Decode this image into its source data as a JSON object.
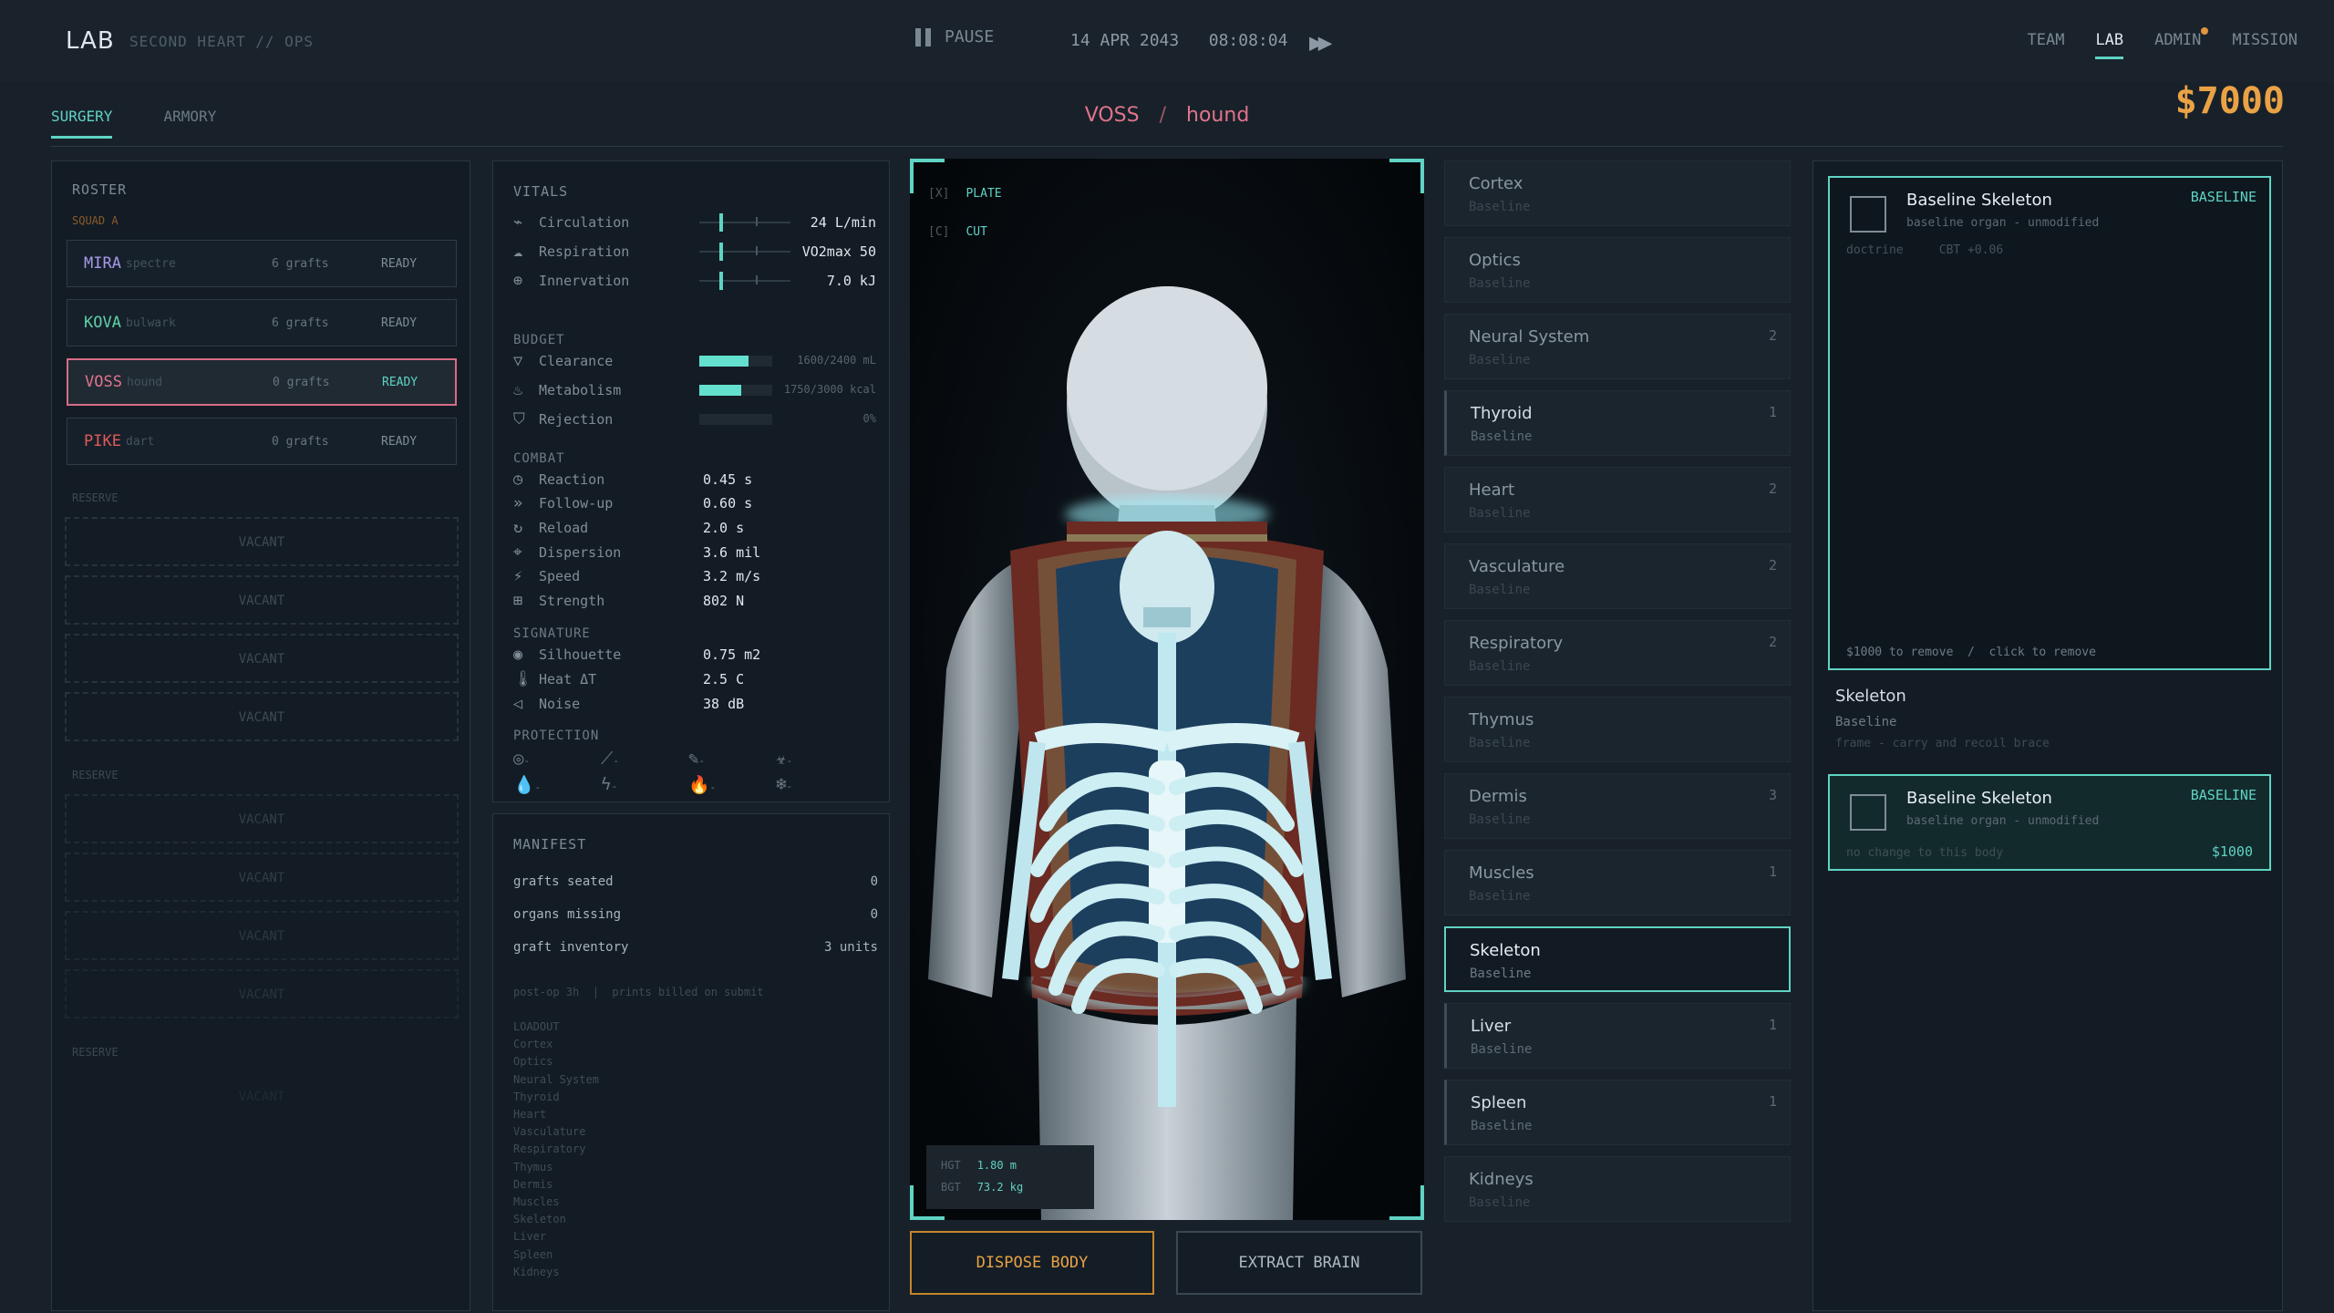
{
  "header": {
    "brand": "LAB",
    "subtitle": "SECOND HEART // OPS",
    "pause_label": "PAUSE",
    "date": "14 APR 2043",
    "time": "08:08:04",
    "nav": [
      "TEAM",
      "LAB",
      "ADMIN",
      "MISSION"
    ],
    "active_nav": "LAB"
  },
  "tabs": [
    "SURGERY",
    "ARMORY"
  ],
  "breadcrumb": {
    "name": "VOSS",
    "sep": "/",
    "callsign": "hound"
  },
  "money": "$7000",
  "roster": {
    "title": "ROSTER",
    "squad": "SQUAD A",
    "members": [
      {
        "name": "MIRA",
        "callsign": "spectre",
        "grafts": "6 grafts",
        "status": "READY",
        "color": "#a79ae8"
      },
      {
        "name": "KOVA",
        "callsign": "bulwark",
        "grafts": "6 grafts",
        "status": "READY",
        "color": "#5fd3a6"
      },
      {
        "name": "VOSS",
        "callsign": "hound",
        "grafts": "0 grafts",
        "status": "READY",
        "color": "#e0748a"
      },
      {
        "name": "PIKE",
        "callsign": "dart",
        "grafts": "0 grafts",
        "status": "READY",
        "color": "#e05a5a"
      }
    ],
    "reserve_label": "RESERVE",
    "vacant_label": "VACANT"
  },
  "vitals": {
    "title": "VITALS",
    "rows": [
      {
        "icon": "pulse-icon",
        "glyph": "⌁",
        "label": "Circulation",
        "value": "24 L/min"
      },
      {
        "icon": "lungs-icon",
        "glyph": "☁",
        "label": "Respiration",
        "value": "VO2max 50"
      },
      {
        "icon": "nerve-icon",
        "glyph": "⊕",
        "label": "Innervation",
        "value": "7.0 kJ"
      }
    ],
    "budget_title": "BUDGET",
    "budget": [
      {
        "icon": "filter-icon",
        "glyph": "▽",
        "label": "Clearance",
        "value": "1600/2400 mL",
        "fill": 0.67
      },
      {
        "icon": "flame-icon",
        "glyph": "♨",
        "label": "Metabolism",
        "value": "1750/3000 kcal",
        "fill": 0.58
      },
      {
        "icon": "shield-icon",
        "glyph": "⛉",
        "label": "Rejection",
        "value": "0%",
        "fill": 0
      }
    ],
    "combat_title": "COMBAT",
    "combat": [
      {
        "icon": "clock-icon",
        "glyph": "◷",
        "label": "Reaction",
        "value": "0.45 s"
      },
      {
        "icon": "chevrons-icon",
        "glyph": "»",
        "label": "Follow-up",
        "value": "0.60 s"
      },
      {
        "icon": "reload-icon",
        "glyph": "↻",
        "label": "Reload",
        "value": "2.0 s"
      },
      {
        "icon": "crosshair-icon",
        "glyph": "⌖",
        "label": "Dispersion",
        "value": "3.6 mil"
      },
      {
        "icon": "run-icon",
        "glyph": "⚡",
        "label": "Speed",
        "value": "3.2 m/s"
      },
      {
        "icon": "dumbbell-icon",
        "glyph": "⊞",
        "label": "Strength",
        "value": "802 N"
      }
    ],
    "signature_title": "SIGNATURE",
    "signature": [
      {
        "icon": "eye-icon",
        "glyph": "◉",
        "label": "Silhouette",
        "value": "0.75 m2"
      },
      {
        "icon": "thermometer-icon",
        "glyph": "🌡",
        "label": "Heat ΔT",
        "value": "2.5 C"
      },
      {
        "icon": "speaker-icon",
        "glyph": "◁",
        "label": "Noise",
        "value": "38 dB"
      }
    ],
    "protection_title": "PROTECTION",
    "protection": [
      {
        "icon": "target-icon",
        "glyph": "◎",
        "value": "-"
      },
      {
        "icon": "blade-icon",
        "glyph": "⟋",
        "value": "-"
      },
      {
        "icon": "pen-icon",
        "glyph": "✎",
        "value": "-"
      },
      {
        "icon": "bio-icon",
        "glyph": "☣",
        "value": "-"
      },
      {
        "icon": "droplet-icon",
        "glyph": "💧",
        "value": "-"
      },
      {
        "icon": "bolt-icon",
        "glyph": "ϟ",
        "value": "-"
      },
      {
        "icon": "fire-icon",
        "glyph": "🔥",
        "value": "-"
      },
      {
        "icon": "snow-icon",
        "glyph": "❄",
        "value": "-"
      }
    ]
  },
  "manifest": {
    "title": "MANIFEST",
    "rows": [
      {
        "label": "grafts seated",
        "value": "0"
      },
      {
        "label": "organs missing",
        "value": "0"
      },
      {
        "label": "graft inventory",
        "value": "3 units"
      }
    ],
    "note": "post-op 3h  |  prints billed on submit",
    "loadout_title": "LOADOUT",
    "loadout": [
      "Cortex",
      "Optics",
      "Neural System",
      "Thyroid",
      "Heart",
      "Vasculature",
      "Respiratory",
      "Thymus",
      "Dermis",
      "Muscles",
      "Skeleton",
      "Liver",
      "Spleen",
      "Kidneys"
    ]
  },
  "viewport": {
    "modes": [
      {
        "key": "[X]",
        "label": "PLATE"
      },
      {
        "key": "[C]",
        "label": "CUT"
      }
    ],
    "stats": [
      {
        "key": "HGT",
        "value": "1.80 m"
      },
      {
        "key": "BGT",
        "value": "73.2 kg"
      }
    ]
  },
  "actions": {
    "dispose": "DISPOSE BODY",
    "extract": "EXTRACT BRAIN"
  },
  "organs": [
    {
      "name": "Cortex",
      "sub": "Baseline",
      "count": ""
    },
    {
      "name": "Optics",
      "sub": "Baseline",
      "count": ""
    },
    {
      "name": "Neural System",
      "sub": "Baseline",
      "count": "2"
    },
    {
      "name": "Thyroid",
      "sub": "Baseline",
      "count": "1",
      "mod": true
    },
    {
      "name": "Heart",
      "sub": "Baseline",
      "count": "2"
    },
    {
      "name": "Vasculature",
      "sub": "Baseline",
      "count": "2"
    },
    {
      "name": "Respiratory",
      "sub": "Baseline",
      "count": "2"
    },
    {
      "name": "Thymus",
      "sub": "Baseline",
      "count": ""
    },
    {
      "name": "Dermis",
      "sub": "Baseline",
      "count": "3"
    },
    {
      "name": "Muscles",
      "sub": "Baseline",
      "count": "1"
    },
    {
      "name": "Skeleton",
      "sub": "Baseline",
      "count": "",
      "sel": true
    },
    {
      "name": "Liver",
      "sub": "Baseline",
      "count": "1",
      "mod": true
    },
    {
      "name": "Spleen",
      "sub": "Baseline",
      "count": "1",
      "mod": true
    },
    {
      "name": "Kidneys",
      "sub": "Baseline",
      "count": ""
    }
  ],
  "detail": {
    "installed": {
      "title": "Baseline Skeleton",
      "sub": "baseline organ - unmodified",
      "badge": "BASELINE",
      "meta_a": "doctrine",
      "meta_b": "CBT +0.06",
      "footer": "$1000 to remove  /  click to remove"
    },
    "slot": {
      "name": "Skeleton",
      "sub": "Baseline",
      "desc": "frame - carry and recoil brace"
    },
    "option": {
      "title": "Baseline Skeleton",
      "sub": "baseline organ - unmodified",
      "badge": "BASELINE",
      "footer": "no change to this body",
      "price": "$1000"
    }
  },
  "colors": {
    "accent": "#5fd3c4",
    "money": "#e9a245",
    "selected": "#d76c86"
  }
}
